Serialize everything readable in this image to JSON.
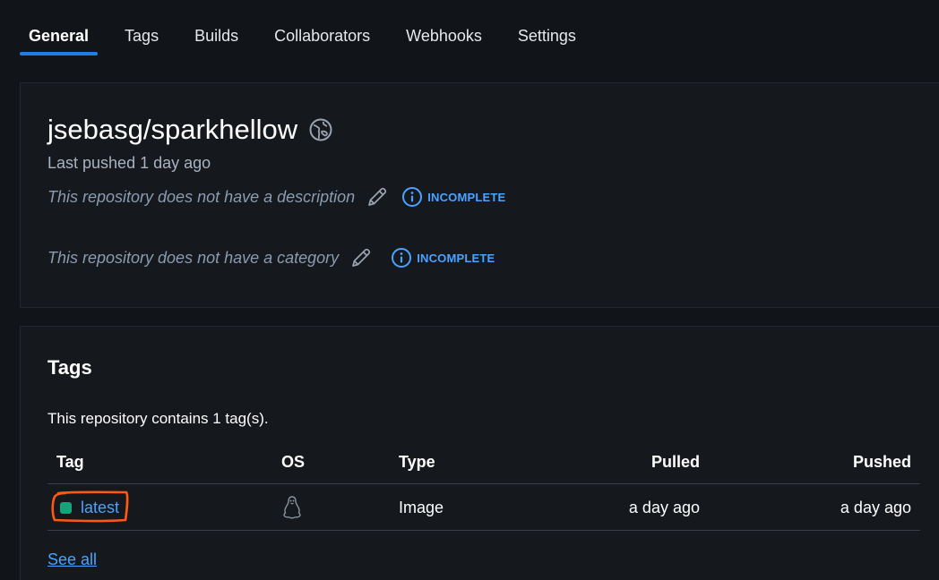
{
  "tabs": [
    {
      "label": "General",
      "active": true
    },
    {
      "label": "Tags",
      "active": false
    },
    {
      "label": "Builds",
      "active": false
    },
    {
      "label": "Collaborators",
      "active": false
    },
    {
      "label": "Webhooks",
      "active": false
    },
    {
      "label": "Settings",
      "active": false
    }
  ],
  "repo": {
    "name": "jsebasg/sparkhellow",
    "visibility_icon": "globe-icon",
    "last_pushed": "Last pushed 1 day ago",
    "description": {
      "text": "This repository does not have a description",
      "status": "INCOMPLETE"
    },
    "category": {
      "text": "This repository does not have a category",
      "status": "INCOMPLETE"
    }
  },
  "tags_section": {
    "title": "Tags",
    "count_text": "This repository contains 1 tag(s).",
    "columns": {
      "tag": "Tag",
      "os": "OS",
      "type": "Type",
      "pulled": "Pulled",
      "pushed": "Pushed"
    },
    "rows": [
      {
        "tag": "latest",
        "os_icon": "linux-icon",
        "type": "Image",
        "pulled": "a day ago",
        "pushed": "a day ago"
      }
    ],
    "see_all": "See all"
  },
  "colors": {
    "background": "#111419",
    "accent": "#1f7ee7",
    "link": "#4aa3ff",
    "tag_status": "#15a37a",
    "annotation": "#ff5a14"
  }
}
